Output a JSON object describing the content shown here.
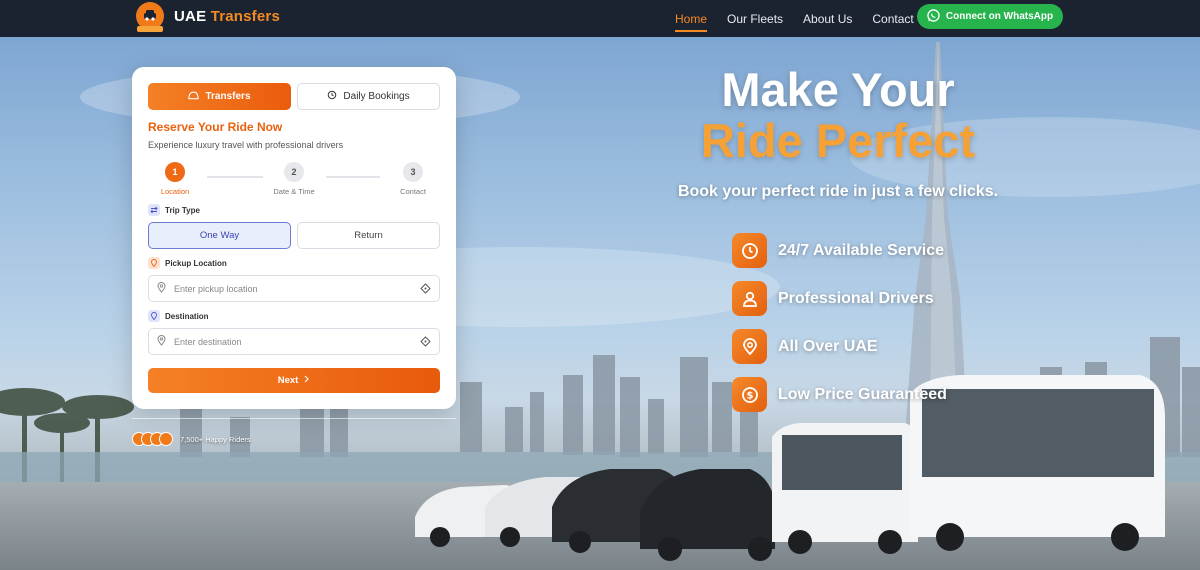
{
  "nav": {
    "brand_main": "UAE",
    "brand_accent": "Transfers",
    "links": [
      {
        "label": "Home",
        "active": true
      },
      {
        "label": "Our Fleets",
        "active": false
      },
      {
        "label": "About Us",
        "active": false
      },
      {
        "label": "Contact",
        "active": false
      }
    ],
    "whatsapp_label": "Connect on WhatsApp"
  },
  "form": {
    "tabs": [
      {
        "label": "Transfers",
        "icon": "car-icon",
        "active": true
      },
      {
        "label": "Daily Bookings",
        "icon": "history-icon",
        "active": false
      }
    ],
    "title": "Reserve Your Ride Now",
    "subtitle": "Experience luxury travel with professional drivers",
    "steps": [
      {
        "number": "1",
        "label": "Location",
        "active": true
      },
      {
        "number": "2",
        "label": "Date & Time",
        "active": false
      },
      {
        "number": "3",
        "label": "Contact",
        "active": false
      }
    ],
    "trip_type_label": "Trip Type",
    "trip_options": [
      {
        "label": "One Way",
        "selected": true
      },
      {
        "label": "Return",
        "selected": false
      }
    ],
    "pickup_label": "Pickup Location",
    "pickup_placeholder": "Enter pickup location",
    "pickup_value": "",
    "destination_label": "Destination",
    "destination_placeholder": "Enter destination",
    "destination_value": "",
    "next_label": "Next"
  },
  "riders": {
    "text": "7,500+ Happy Riders"
  },
  "hero": {
    "title_line1": "Make Your",
    "title_line2": "Ride Perfect",
    "subtitle": "Book your perfect ride in just a few clicks.",
    "features": [
      {
        "icon": "clock-icon",
        "label": "24/7 Available Service"
      },
      {
        "icon": "user-icon",
        "label": "Professional Drivers"
      },
      {
        "icon": "map-pin-icon",
        "label": "All Over UAE"
      },
      {
        "icon": "dollar-icon",
        "label": "Low Price Guaranteed"
      }
    ]
  },
  "colors": {
    "brand_orange": "#ee6a14",
    "nav_bg": "#1b2230",
    "whatsapp_green": "#27b44d",
    "accent_gold": "#f6a136"
  }
}
